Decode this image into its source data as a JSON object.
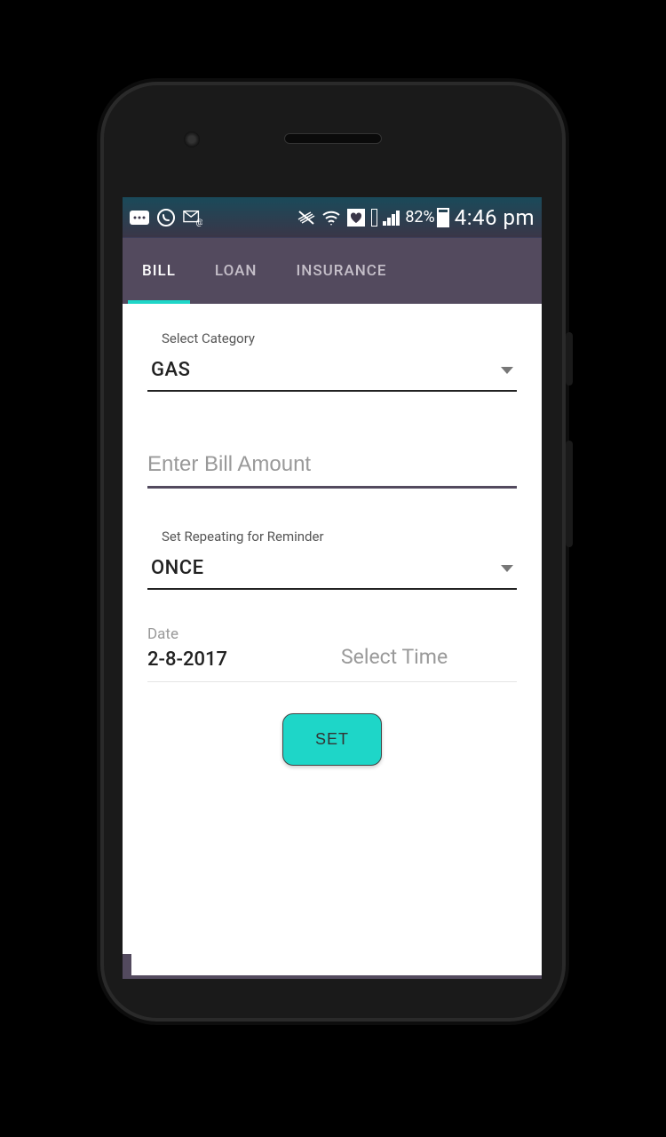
{
  "status": {
    "battery_pct": "82%",
    "time": "4:46 pm"
  },
  "tabs": [
    {
      "label": "BILL",
      "active": true
    },
    {
      "label": "LOAN",
      "active": false
    },
    {
      "label": "INSURANCE",
      "active": false
    }
  ],
  "form": {
    "category": {
      "label": "Select Category",
      "value": "GAS"
    },
    "amount": {
      "placeholder": "Enter Bill Amount",
      "value": ""
    },
    "repeating": {
      "label": "Set Repeating for Reminder",
      "value": "ONCE"
    },
    "date": {
      "label": "Date",
      "value": "2-8-2017"
    },
    "time": {
      "placeholder": "Select Time"
    },
    "submit_label": "SET"
  }
}
